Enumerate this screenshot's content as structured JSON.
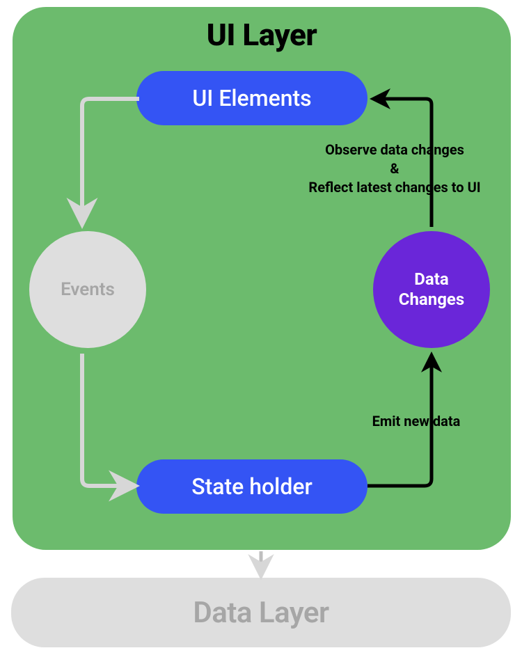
{
  "layers": {
    "ui_title": "UI Layer",
    "data_title": "Data Layer"
  },
  "nodes": {
    "ui_elements": "UI Elements",
    "state_holder": "State holder",
    "events": "Events",
    "data_changes": "Data\nChanges"
  },
  "annotations": {
    "observe_line1": "Observe data changes",
    "observe_line2": "&",
    "observe_line3": "Reflect latest changes to UI",
    "emit": "Emit new data"
  },
  "colors": {
    "green": "#6cbb6d",
    "blue": "#3454f4",
    "purple": "#6a26d9",
    "grey": "#dedede",
    "grey_text": "#a6a6a6"
  }
}
